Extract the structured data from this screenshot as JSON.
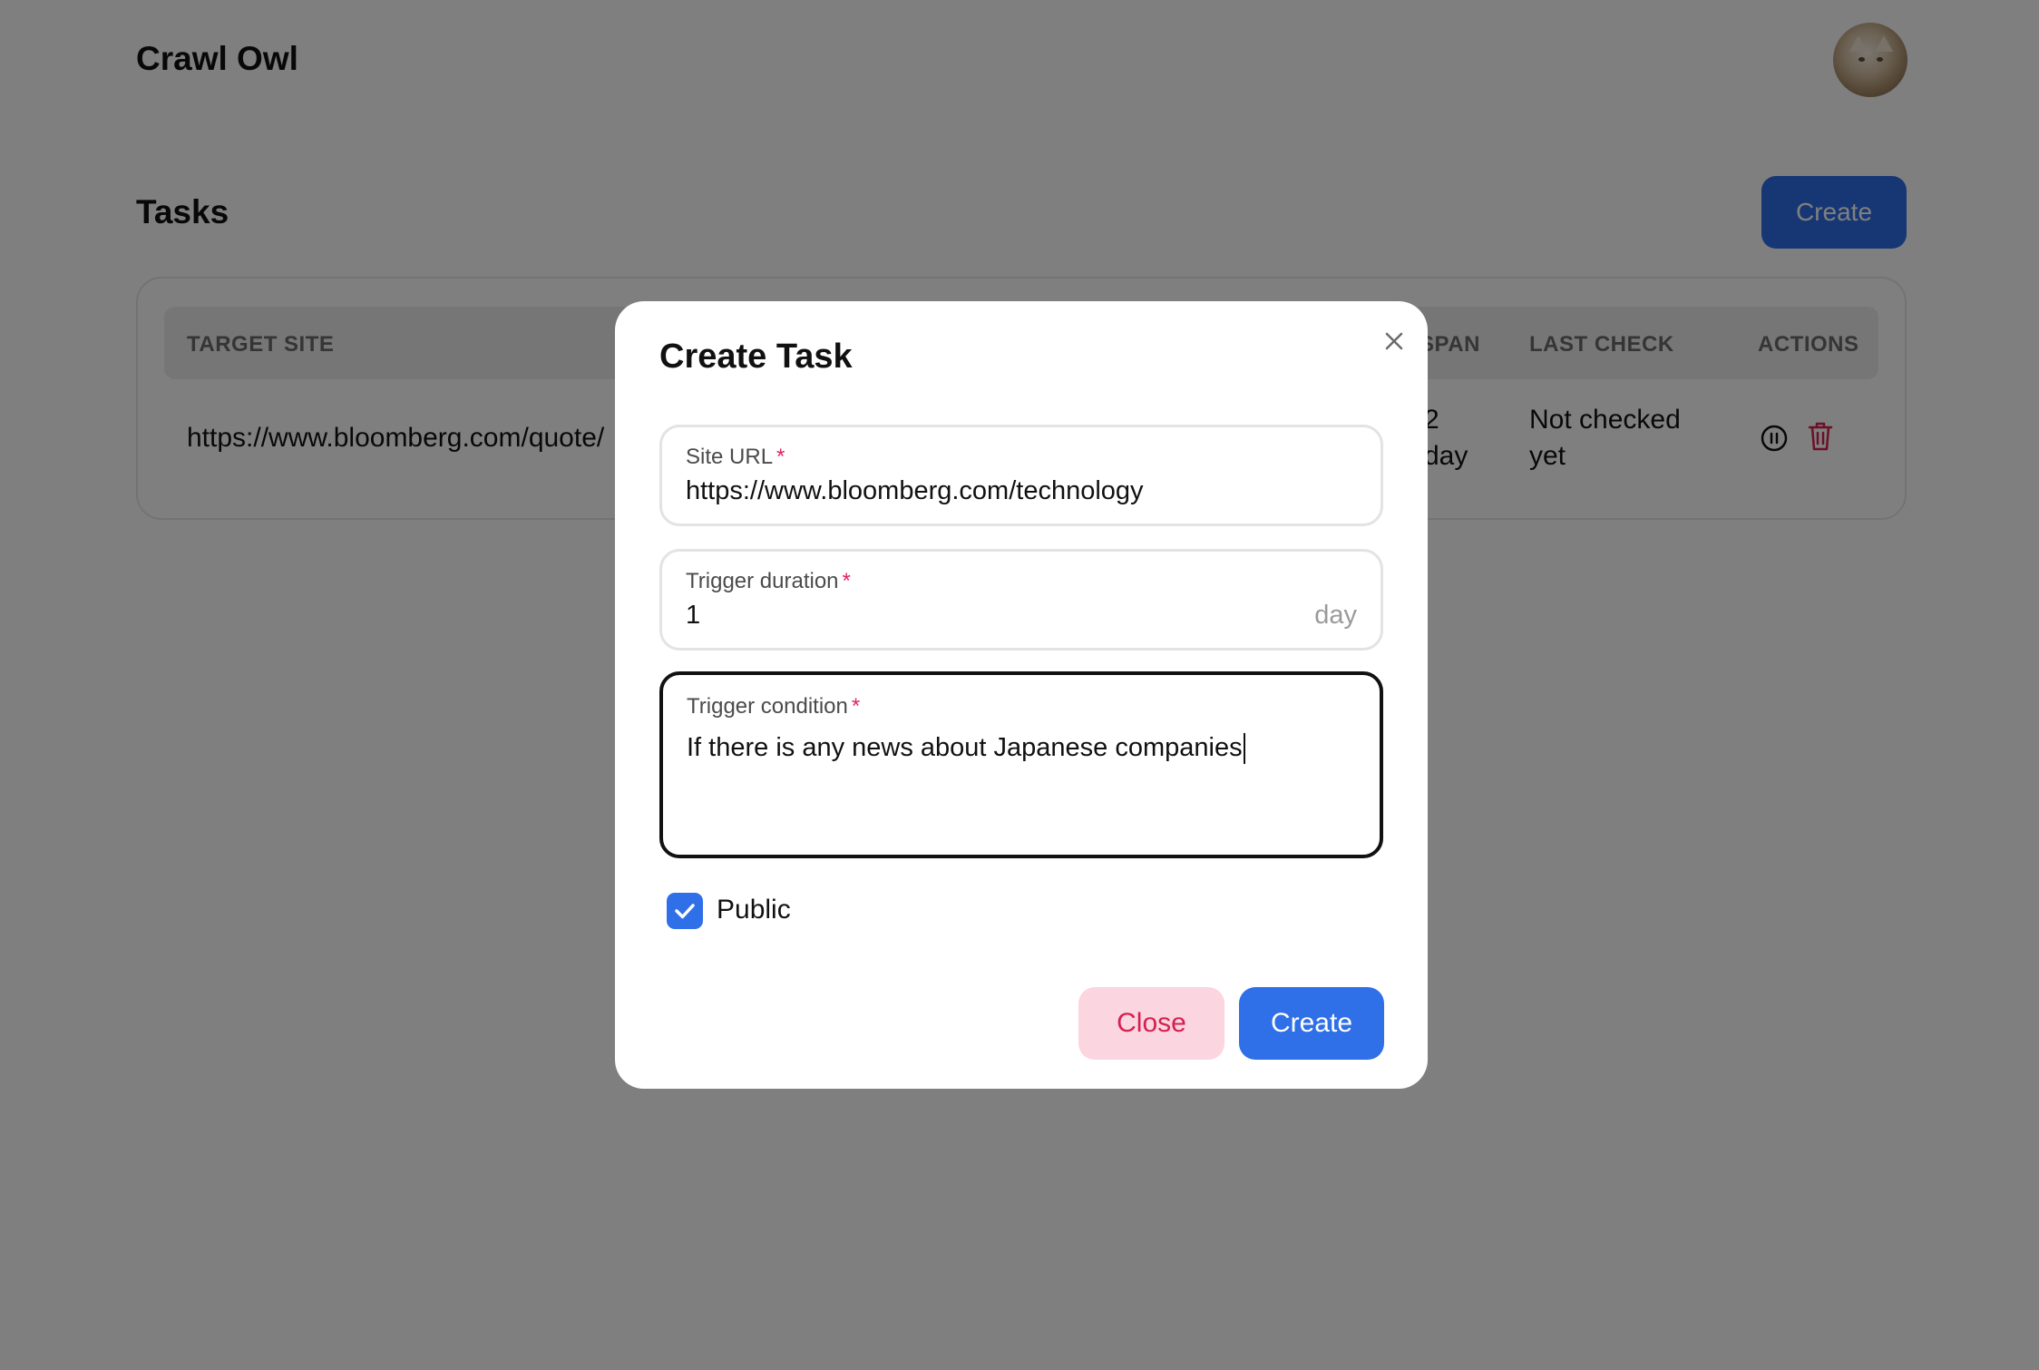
{
  "app": {
    "title": "Crawl Owl"
  },
  "page": {
    "title": "Tasks",
    "create_label": "Create"
  },
  "table": {
    "columns": [
      "TARGET SITE",
      "SPAN",
      "LAST CHECK",
      "ACTIONS"
    ],
    "rows": [
      {
        "target_site": "https://www.bloomberg.com/quote/",
        "span_line1": "2",
        "span_line2": "day",
        "last_check_line1": "Not checked",
        "last_check_line2": "yet",
        "actions": [
          "pause-icon",
          "trash-icon"
        ]
      }
    ]
  },
  "modal": {
    "title": "Create Task",
    "site_url": {
      "label": "Site URL",
      "required": "*",
      "value": "https://www.bloomberg.com/technology"
    },
    "trigger_duration": {
      "label": "Trigger duration",
      "required": "*",
      "value": "1",
      "unit": "day"
    },
    "trigger_condition": {
      "label": "Trigger condition",
      "required": "*",
      "value": "If there is any news about Japanese companies"
    },
    "public": {
      "label": "Public",
      "checked": true
    },
    "close_label": "Close",
    "create_label": "Create"
  },
  "colors": {
    "primary": "#2f6fe8",
    "danger": "#d6204f",
    "danger_bg": "#fbd5df",
    "overlay": "rgba(0,0,0,0.5)"
  }
}
